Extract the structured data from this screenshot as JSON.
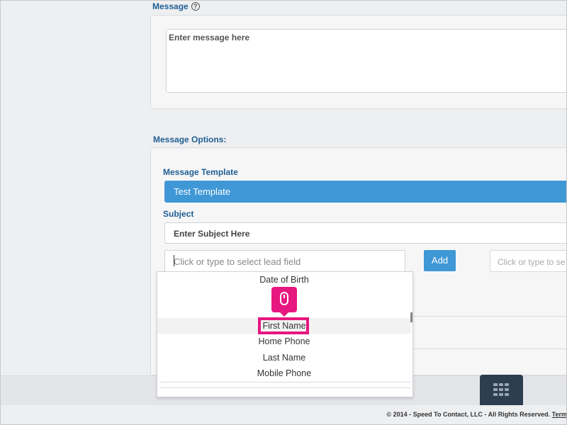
{
  "message": {
    "label": "Message",
    "help_icon": "question-circle-icon",
    "placeholder": "Enter message here"
  },
  "message_options": {
    "label": "Message Options:",
    "template_label": "Message Template",
    "template_value": "Test Template",
    "subject_label": "Subject",
    "subject_value": "Enter Subject Here",
    "lead_field_placeholder": "Click or type to select lead field",
    "add_button": "Add",
    "lead_field_placeholder_2": "Click or type to se"
  },
  "dropdown": {
    "items": [
      "Date of Birth",
      "First Name",
      "Home Phone",
      "Last Name",
      "Mobile Phone"
    ],
    "selected": "First Name"
  },
  "annotation": {
    "icon": "mouse-click-icon",
    "color": "#e6177f"
  },
  "footer": {
    "copyright": "© 2014 - Speed To Contact, LLC - All Rights Reserved.",
    "terms": "Term"
  },
  "colors": {
    "accent": "#3f97d6",
    "label": "#1f5f94",
    "keypad": "#2d3e50"
  }
}
